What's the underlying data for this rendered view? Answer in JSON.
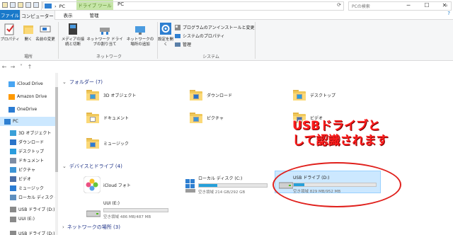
{
  "window": {
    "title": "PC",
    "context_tab": "ドライブ ツール",
    "controls": [
      "─",
      "☐",
      "✕"
    ]
  },
  "tabs": {
    "file": "ファイル",
    "computer": "コンピューター",
    "view": "表示",
    "manage": "管理"
  },
  "ribbon": {
    "location_group": "場所",
    "network_group": "ネットワーク",
    "system_group": "システム",
    "buttons": {
      "properties": "プロパティ",
      "open": "開く",
      "rename": "名前の変更",
      "media": "メディアの接続と切断",
      "map_drive": "ネットワーク ドライブの割り当て",
      "add_location": "ネットワークの場所の追加",
      "settings": "設定を開く"
    },
    "system_items": [
      "プログラムのアンインストールと変更",
      "システムのプロパティ",
      "管理"
    ]
  },
  "address": {
    "path": "PC",
    "search_placeholder": "PCの検索"
  },
  "navpane": [
    {
      "label": "iCloud Drive",
      "color": "#49a5f2"
    },
    {
      "label": "Amazon Drive",
      "color": "#ff9900"
    },
    {
      "label": "OneDrive",
      "color": "#2b7cd3"
    },
    {
      "label": "PC",
      "color": "#2e7fd1",
      "selected": true
    },
    {
      "label": "3D オブジェクト",
      "color": "#3aa0d8"
    },
    {
      "label": "ダウンロード",
      "color": "#2a74c9"
    },
    {
      "label": "デスクトップ",
      "color": "#2a9cdd"
    },
    {
      "label": "ドキュメント",
      "color": "#7e8da4"
    },
    {
      "label": "ピクチャ",
      "color": "#3d95d6"
    },
    {
      "label": "ビデオ",
      "color": "#4b6ea8"
    },
    {
      "label": "ミュージック",
      "color": "#2b7cd3"
    },
    {
      "label": "ローカル ディスク (C:)",
      "color": "#5e8fbf"
    },
    {
      "label": "USB ドライブ (D:)",
      "color": "#8a8a8a"
    },
    {
      "label": "UUI (E:)",
      "color": "#8a8a8a"
    },
    {
      "label": "USB ドライブ (D:)",
      "color": "#8a8a8a"
    }
  ],
  "sections": {
    "folders": "フォルダー (7)",
    "devices": "デバイスとドライブ (4)",
    "network": "ネットワークの場所 (3)"
  },
  "folders": [
    {
      "label": "3D オブジェクト",
      "emblem": "#3aa0d8"
    },
    {
      "label": "ダウンロード",
      "emblem": "#2a74c9"
    },
    {
      "label": "デスクトップ",
      "emblem": "#2a9cdd"
    },
    {
      "label": "ドキュメント",
      "emblem": "#ffffff"
    },
    {
      "label": "ピクチャ",
      "emblem": "#3d95d6"
    },
    {
      "label": "ビデオ",
      "emblem": "#4b6ea8"
    },
    {
      "label": "ミュージック",
      "emblem": "#2b7cd3"
    }
  ],
  "drives": {
    "icloud": {
      "label": "iCloud フォト"
    },
    "c": {
      "label": "ローカル ディスク (C:)",
      "free": "空き領域 214 GB/292 GB",
      "used_fraction": 0.27
    },
    "d": {
      "label": "USB ドライブ (D:)",
      "free": "空き領域 829 MB/952 MB",
      "used_fraction": 0.13
    },
    "e": {
      "label": "UUI (E:)",
      "free": "空き領域 486 MB/487 MB",
      "used_fraction": 0.0
    }
  },
  "annotation": {
    "line1": "USBドライブと",
    "line2": "して認識されます",
    "color": "#ff1d1d"
  }
}
